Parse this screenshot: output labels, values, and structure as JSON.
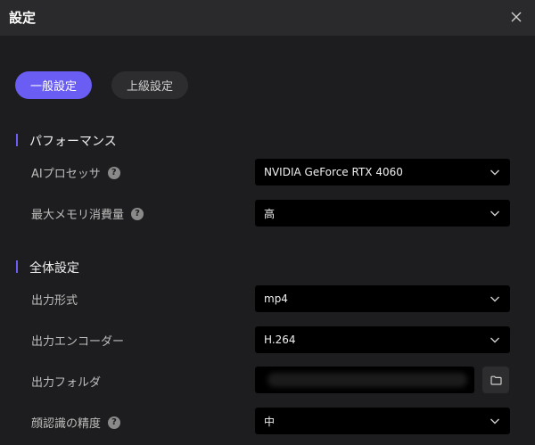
{
  "window": {
    "title": "設定"
  },
  "tabs": [
    {
      "label": "一般設定",
      "active": true
    },
    {
      "label": "上級設定",
      "active": false
    }
  ],
  "sections": {
    "performance": {
      "title": "パフォーマンス",
      "ai_processor": {
        "label": "AIプロセッサ",
        "value": "NVIDIA GeForce RTX 4060"
      },
      "max_memory": {
        "label": "最大メモリ消費量",
        "value": "高"
      }
    },
    "general": {
      "title": "全体設定",
      "output_format": {
        "label": "出力形式",
        "value": "mp4"
      },
      "output_encoder": {
        "label": "出力エンコーダー",
        "value": "H.264"
      },
      "output_folder": {
        "label": "出力フォルダ"
      },
      "face_recognition": {
        "label": "顔認識の精度",
        "value": "中"
      }
    }
  },
  "help_glyph": "?",
  "colors": {
    "accent": "#6a5df3",
    "background": "#1d1d1f",
    "titlebar": "#2a2a2c",
    "field": "#000000"
  },
  "icons": [
    "close-icon",
    "help-icon",
    "chevron-down-icon",
    "folder-icon"
  ]
}
